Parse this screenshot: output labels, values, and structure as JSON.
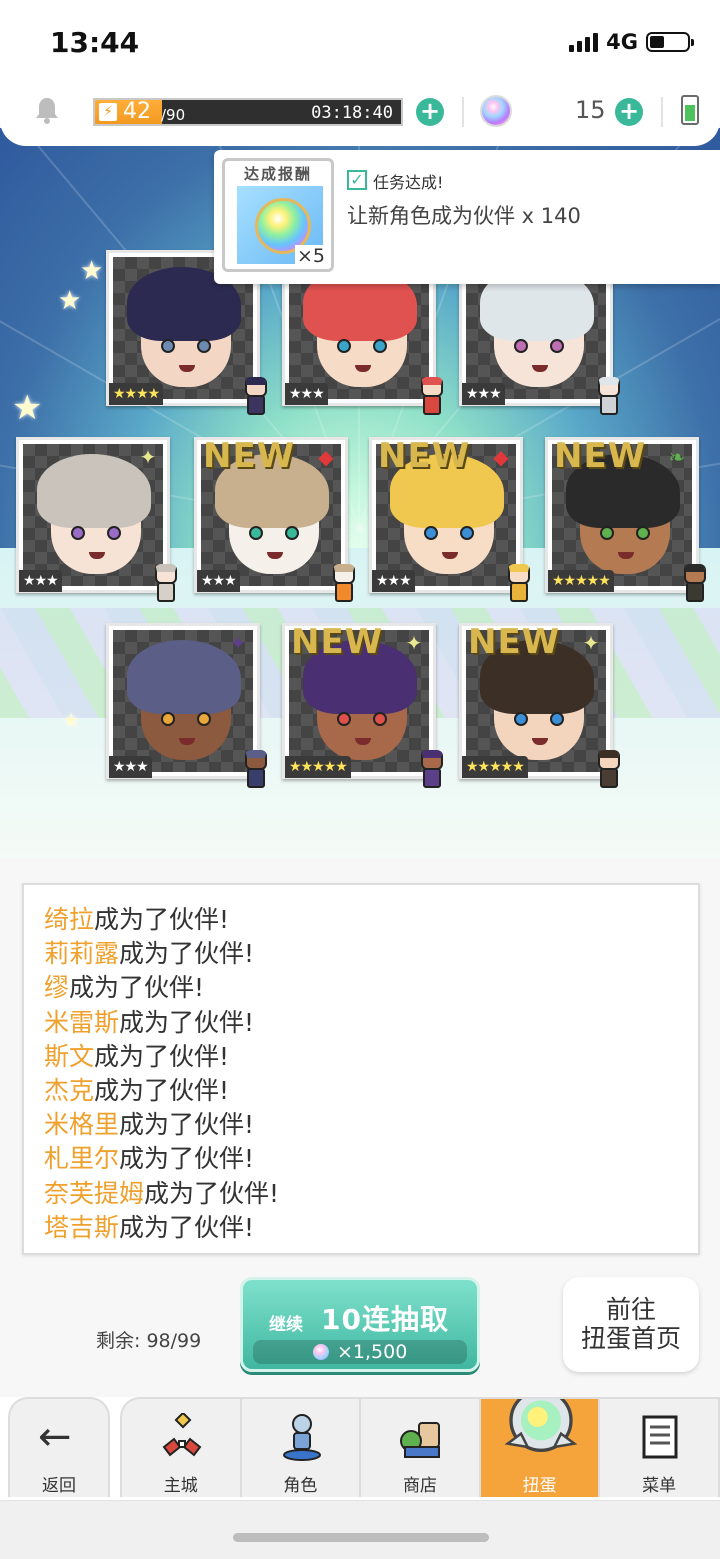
{
  "status_bar": {
    "time": "13:44",
    "network": "4G"
  },
  "header": {
    "stamina_current": "42",
    "stamina_max": "/90",
    "stamina_fraction": 0.467,
    "timer": "03:18:40",
    "gems": "15"
  },
  "mission": {
    "reward_title": "达成报酬",
    "reward_qty": "×5",
    "status": "任务达成!",
    "text": "让新角色成为伙伴  x 140"
  },
  "cards_packed": "0|0|1|4|·;0|1|2|3|·;0|2|3|3|·;1|0|4|3|l;1|1|5|3|nf;1|2|6|3|nf;1|3|7|5|ng;2|0|8|3|d;2|1|9|5|nl;2|2|10|5|nl",
  "card_style": {
    "1": {
      "hair": "#2d2a52",
      "skin": "#f3d7c4",
      "eye": "#6d8bb0",
      "chibi": "#3b3560"
    },
    "2": {
      "hair": "#e0524f",
      "skin": "#f6dcc7",
      "eye": "#3aa4c9",
      "chibi": "#d9483e"
    },
    "3": {
      "hair": "#dfe6ea",
      "skin": "#f7e4d9",
      "eye": "#c06eb4",
      "chibi": "#cfd3d6"
    },
    "4": {
      "hair": "#c9c3bb",
      "skin": "#f6e3d6",
      "eye": "#9a6cc8",
      "chibi": "#d7d0c6"
    },
    "5": {
      "hair": "#c8b08f",
      "skin": "#f5f1ea",
      "eye": "#3ab89a",
      "chibi": "#f08a2c"
    },
    "6": {
      "hair": "#f1c84f",
      "skin": "#f7dcc6",
      "eye": "#3a8fd6",
      "chibi": "#e9b238"
    },
    "7": {
      "hair": "#2a2a2a",
      "skin": "#b47a52",
      "eye": "#5fb04f",
      "chibi": "#3b3a32"
    },
    "8": {
      "hair": "#5b5e86",
      "skin": "#8c5a3e",
      "eye": "#e9a63a",
      "chibi": "#3a3e6a"
    },
    "9": {
      "hair": "#4a2f73",
      "skin": "#a7694a",
      "eye": "#e0504a",
      "chibi": "#5b3f88"
    },
    "10": {
      "hair": "#3c2f26",
      "skin": "#f3d4bd",
      "eye": "#3a8fd6",
      "chibi": "#4a3d33"
    }
  },
  "new_label": "NEW",
  "log": [
    {
      "name": "绮拉",
      "text": "成为了伙伴!"
    },
    {
      "name": "莉莉露",
      "text": "成为了伙伴!"
    },
    {
      "name": "缪",
      "text": "成为了伙伴!"
    },
    {
      "name": "米雷斯",
      "text": "成为了伙伴!"
    },
    {
      "name": "斯文",
      "text": "成为了伙伴!"
    },
    {
      "name": "杰克",
      "text": "成为了伙伴!"
    },
    {
      "name": "米格里",
      "text": "成为了伙伴!"
    },
    {
      "name": "札里尔",
      "text": "成为了伙伴!"
    },
    {
      "name": "奈芙提姆",
      "text": "成为了伙伴!"
    },
    {
      "name": "塔吉斯",
      "text": "成为了伙伴!"
    }
  ],
  "gacha": {
    "remaining": "剩余:  98/99",
    "pull_small": "继续",
    "pull_big": "10连抽取",
    "cost": "×1,500",
    "go_home_1": "前往",
    "go_home_2": "扭蛋首页"
  },
  "nav": {
    "back": "返回",
    "tabs": [
      "主城",
      "角色",
      "商店",
      "扭蛋",
      "菜单"
    ],
    "active": 3
  },
  "colors": {
    "accent": "#3ab89a",
    "stamina": "#f29a22",
    "log_name": "#f0a02c",
    "tab_active": "#f5a43c"
  }
}
